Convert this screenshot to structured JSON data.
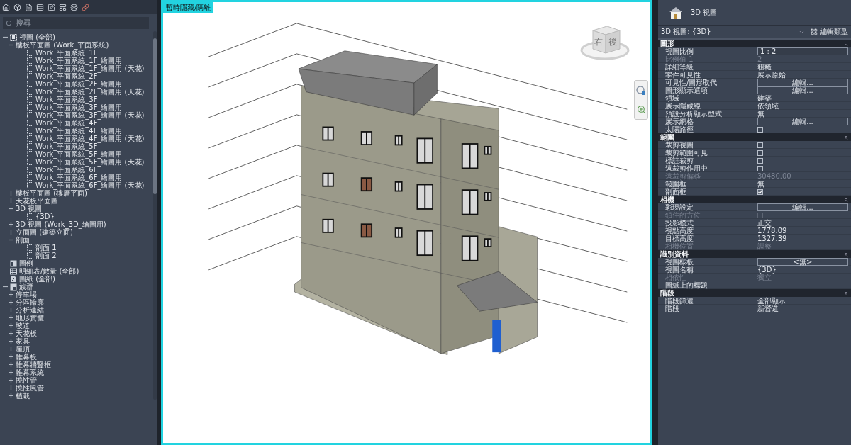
{
  "browser": {
    "search": {
      "placeholder": "搜尋"
    },
    "tree": [
      {
        "label": "視圖 (全部)",
        "kind": "views",
        "expanded": true,
        "children": [
          {
            "label": "樓板平面圖 (Work_平面系統)",
            "expanded": true,
            "children": [
              {
                "label": "Work_平面系統_1F",
                "kind": "view"
              },
              {
                "label": "Work_平面系統_1F_繪圖用",
                "kind": "view"
              },
              {
                "label": "Work_平面系統_1F_繪圖用 (天花)",
                "kind": "view"
              },
              {
                "label": "Work_平面系統_2F",
                "kind": "view"
              },
              {
                "label": "Work_平面系統_2F_繪圖用",
                "kind": "view"
              },
              {
                "label": "Work_平面系統_2F_繪圖用 (天花)",
                "kind": "view"
              },
              {
                "label": "Work_平面系統_3F",
                "kind": "view"
              },
              {
                "label": "Work_平面系統_3F_繪圖用",
                "kind": "view"
              },
              {
                "label": "Work_平面系統_3F_繪圖用 (天花)",
                "kind": "view"
              },
              {
                "label": "Work_平面系統_4F",
                "kind": "view"
              },
              {
                "label": "Work_平面系統_4F_繪圖用",
                "kind": "view"
              },
              {
                "label": "Work_平面系統_4F_繪圖用 (天花)",
                "kind": "view"
              },
              {
                "label": "Work_平面系統_5F",
                "kind": "view"
              },
              {
                "label": "Work_平面系統_5F_繪圖用",
                "kind": "view"
              },
              {
                "label": "Work_平面系統_5F_繪圖用 (天花)",
                "kind": "view"
              },
              {
                "label": "Work_平面系統_6F",
                "kind": "view"
              },
              {
                "label": "Work_平面系統_6F_繪圖用",
                "kind": "view"
              },
              {
                "label": "Work_平面系統_6F_繪圖用 (天花)",
                "kind": "view"
              }
            ]
          },
          {
            "label": "樓板平面圖 (樓層平面)",
            "expanded": false
          },
          {
            "label": "天花板平面圖",
            "expanded": false
          },
          {
            "label": "3D 視圖",
            "expanded": true,
            "children": [
              {
                "label": "{3D}",
                "kind": "view"
              }
            ]
          },
          {
            "label": "3D 視圖 (Work_3D_繪圖用)",
            "expanded": false
          },
          {
            "label": "立面圖 (建築立面)",
            "expanded": false
          },
          {
            "label": "剖面",
            "expanded": true,
            "children": [
              {
                "label": "剖面 1",
                "kind": "view"
              },
              {
                "label": "剖面 2",
                "kind": "view"
              }
            ]
          }
        ]
      },
      {
        "label": "圖例",
        "kind": "legend"
      },
      {
        "label": "明細表/數量 (全部)",
        "kind": "schedule"
      },
      {
        "label": "圖紙 (全部)",
        "kind": "sheet"
      },
      {
        "label": "族群",
        "kind": "family",
        "expanded": true,
        "children": [
          {
            "label": "停車場",
            "expanded": false
          },
          {
            "label": "分區輪廓",
            "expanded": false
          },
          {
            "label": "分析連結",
            "expanded": false
          },
          {
            "label": "地形實體",
            "expanded": false
          },
          {
            "label": "坡道",
            "expanded": false
          },
          {
            "label": "天花板",
            "expanded": false
          },
          {
            "label": "家具",
            "expanded": false
          },
          {
            "label": "屋頂",
            "expanded": false
          },
          {
            "label": "帷幕板",
            "expanded": false
          },
          {
            "label": "帷幕牆豎框",
            "expanded": false
          },
          {
            "label": "帷幕系統",
            "expanded": false
          },
          {
            "label": "撓性管",
            "expanded": false
          },
          {
            "label": "撓性風管",
            "expanded": false
          },
          {
            "label": "植栽",
            "expanded": false
          }
        ]
      }
    ]
  },
  "view": {
    "tag": "暫時隱藏/隔離",
    "view_cube": {
      "faces": [
        "右",
        "後"
      ]
    }
  },
  "properties": {
    "title": "3D 視圖",
    "type_selector": "3D 視圖: {3D}",
    "edit_type": "編輯類型",
    "sections": [
      {
        "title": "圖形",
        "rows": [
          {
            "label": "視圖比例",
            "kind": "field",
            "value": "1 : 2",
            "disabled": false
          },
          {
            "label": "比例值 1",
            "kind": "text",
            "value": "2",
            "disabled": true
          },
          {
            "label": "詳細等級",
            "kind": "text",
            "value": "粗糙",
            "disabled": false
          },
          {
            "label": "零件可見性",
            "kind": "text",
            "value": "展示原始",
            "disabled": false
          },
          {
            "label": "可見性/圖形取代",
            "kind": "button",
            "value": "編輯...",
            "disabled": false
          },
          {
            "label": "圖形顯示選項",
            "kind": "button",
            "value": "編輯...",
            "disabled": false
          },
          {
            "label": "領域",
            "kind": "text",
            "value": "建築",
            "disabled": false
          },
          {
            "label": "展示隱藏線",
            "kind": "text",
            "value": "依領域",
            "disabled": false
          },
          {
            "label": "預設分析顯示型式",
            "kind": "text",
            "value": "無",
            "disabled": false
          },
          {
            "label": "展示網格",
            "kind": "button",
            "value": "編輯...",
            "disabled": false
          },
          {
            "label": "太陽路徑",
            "kind": "checkbox",
            "checked": false,
            "disabled": false
          }
        ]
      },
      {
        "title": "範圍",
        "rows": [
          {
            "label": "裁剪視圖",
            "kind": "checkbox",
            "checked": false,
            "disabled": false
          },
          {
            "label": "裁剪範圍可見",
            "kind": "checkbox",
            "checked": false,
            "disabled": false
          },
          {
            "label": "標註裁剪",
            "kind": "checkbox",
            "checked": false,
            "disabled": false
          },
          {
            "label": "遠裁剪作用中",
            "kind": "checkbox",
            "checked": false,
            "disabled": false
          },
          {
            "label": "遠裁剪偏移",
            "kind": "text",
            "value": "30480.00",
            "disabled": true
          },
          {
            "label": "範圍框",
            "kind": "text",
            "value": "無",
            "disabled": false
          },
          {
            "label": "剖面框",
            "kind": "checkbox",
            "checked": true,
            "disabled": false
          }
        ]
      },
      {
        "title": "相機",
        "rows": [
          {
            "label": "彩現設定",
            "kind": "button",
            "value": "編輯...",
            "disabled": false
          },
          {
            "label": "鎖住的方位",
            "kind": "checkbox",
            "checked": false,
            "disabled": true
          },
          {
            "label": "投影模式",
            "kind": "text",
            "value": "正交",
            "disabled": false
          },
          {
            "label": "視點高度",
            "kind": "text",
            "value": "1778.09",
            "disabled": false
          },
          {
            "label": "目標高度",
            "kind": "text",
            "value": "1327.39",
            "disabled": false
          },
          {
            "label": "相機位置",
            "kind": "text",
            "value": "調整",
            "disabled": true
          }
        ]
      },
      {
        "title": "識別資料",
        "rows": [
          {
            "label": "視圖樣板",
            "kind": "button",
            "value": "<無>",
            "disabled": false
          },
          {
            "label": "視圖名稱",
            "kind": "text",
            "value": "{3D}",
            "disabled": false
          },
          {
            "label": "相依性",
            "kind": "text",
            "value": "獨立",
            "disabled": true
          },
          {
            "label": "圖紙上的標題",
            "kind": "text",
            "disabled": false
          }
        ]
      },
      {
        "title": "階段",
        "rows": [
          {
            "label": "階段篩選",
            "kind": "text",
            "value": "全部顯示",
            "disabled": false
          },
          {
            "label": "階段",
            "kind": "text",
            "value": "新營造",
            "disabled": false
          }
        ]
      }
    ]
  }
}
